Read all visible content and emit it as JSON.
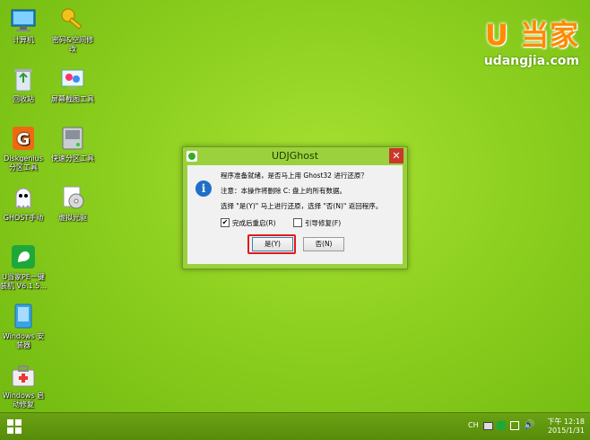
{
  "desktop": {
    "icons": [
      {
        "label": "计算机",
        "icon": "computer-icon"
      },
      {
        "label": "密码&空间修改",
        "icon": "keys-icon"
      },
      {
        "label": "回收站",
        "icon": "recycle-bin-icon"
      },
      {
        "label": "屏幕截图工具",
        "icon": "screenshot-tool-icon"
      },
      {
        "label": "Diskgenius 分区工具",
        "icon": "diskgenius-icon"
      },
      {
        "label": "快速分区工具",
        "icon": "partition-tool-icon"
      },
      {
        "label": "GHOST手动",
        "icon": "ghost-icon"
      },
      {
        "label": "虚拟光驱",
        "icon": "virtual-drive-icon"
      },
      {
        "label": "U当家PE一键 装机 V6.1.5...",
        "icon": "udangjia-installer-icon"
      },
      {
        "label": "Windows 安装器",
        "icon": "windows-installer-icon"
      },
      {
        "label": "Windows 启动修复",
        "icon": "windows-repair-icon"
      }
    ]
  },
  "brand": {
    "logo": "U 当家",
    "url": "udangjia.com",
    "color": "#ff8a00"
  },
  "dialog": {
    "title": "UDJGhost",
    "close_label": "✕",
    "line1": "程序准备就绪，是否马上用 Ghost32 进行还原？",
    "line2": "注意：本操作将删除 C: 盘上的所有数据。",
    "line3": "选择 \"是(Y)\" 马上进行还原，选择 \"否(N)\" 返回程序。",
    "checkbox_restart": {
      "label": "完成后重启(R)",
      "checked": "✔"
    },
    "checkbox_repair": {
      "label": "引导修复(F)",
      "checked": ""
    },
    "yes_label": "是(Y)",
    "no_label": "否(N)"
  },
  "taskbar": {
    "tray_ch": "CH",
    "time": "下午 12:18",
    "date": "2015/1/31"
  }
}
